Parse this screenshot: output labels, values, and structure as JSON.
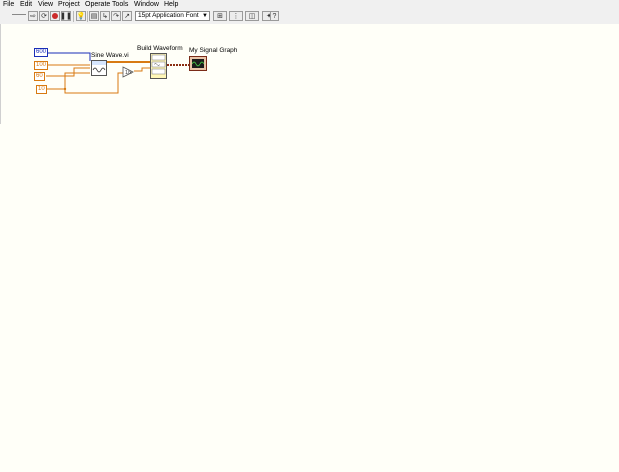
{
  "menu": [
    "File",
    "Edit",
    "View",
    "Project",
    "Operate",
    "Tools",
    "Window",
    "Help"
  ],
  "toolbar": {
    "font_selector": "15pt Application Font"
  },
  "block_diagram": {
    "constants": [
      "600",
      "100",
      "60",
      "10"
    ],
    "sine_wave_label": "Sine Wave.vi",
    "build_waveform_label": "Build Waveform",
    "graph_label": "My Signal Graph"
  },
  "colors": {
    "int_wire": "#1a2eb8",
    "dbl_wire": "#d87a12",
    "waveform_wire": "#8b2d12"
  }
}
